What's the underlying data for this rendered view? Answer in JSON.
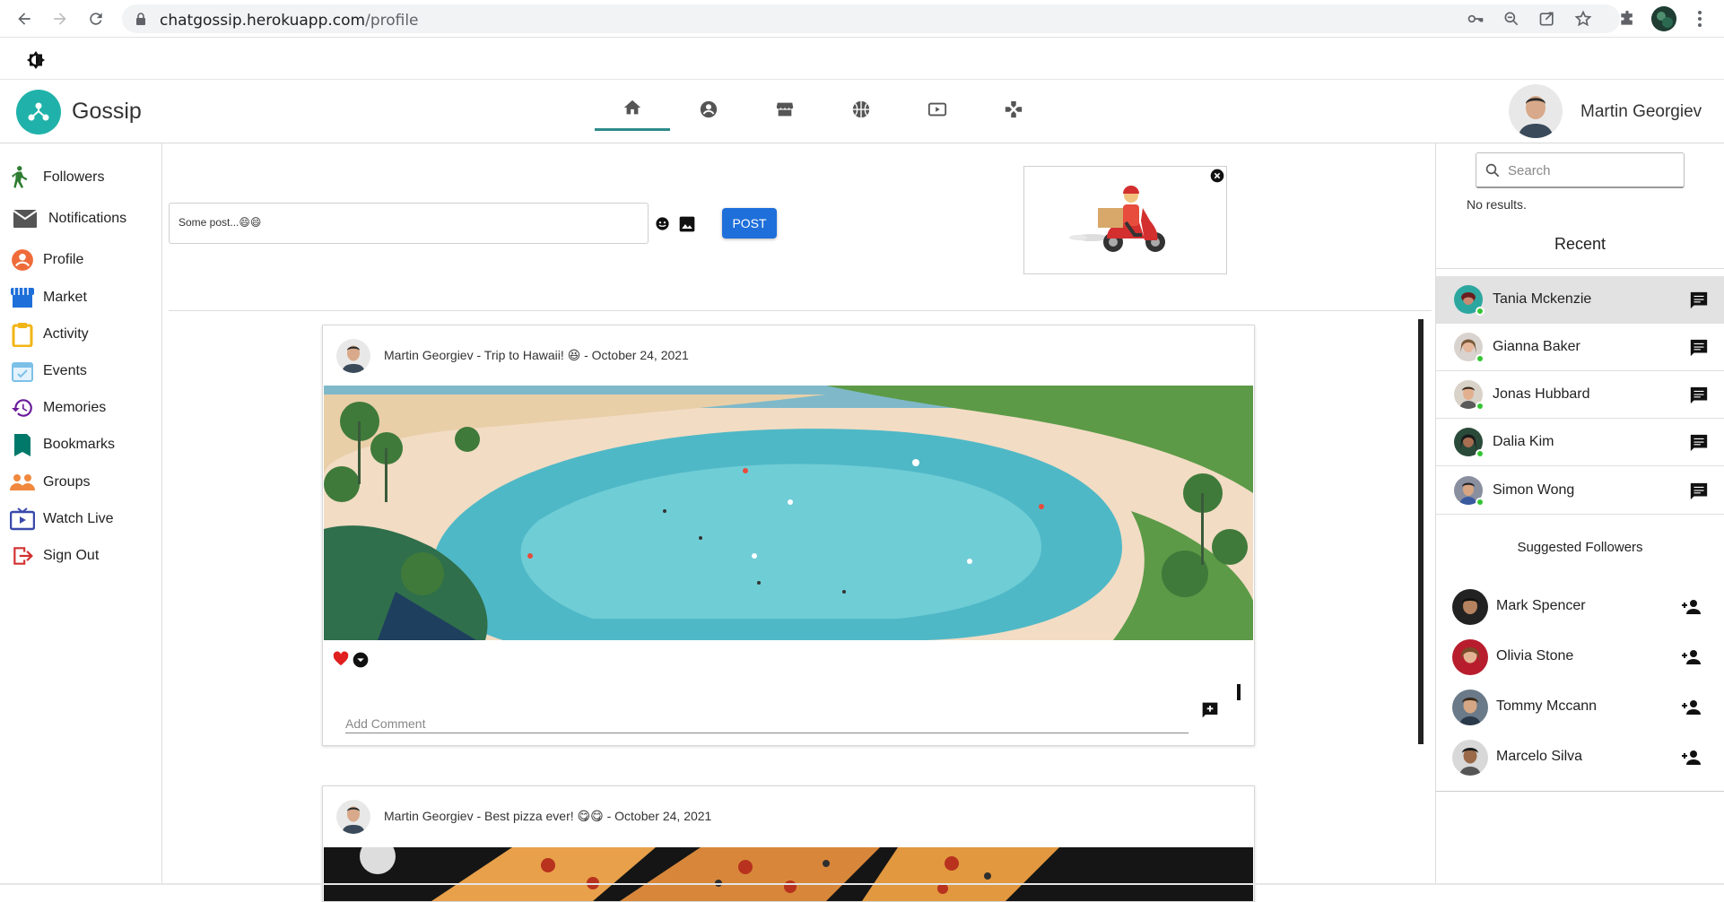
{
  "browser": {
    "url_host": "chatgossip.herokuapp.com",
    "url_path": "/profile"
  },
  "app": {
    "brand": "Gossip",
    "user_name": "Martin Georgiev"
  },
  "nav_tabs": [
    {
      "icon": "home-icon",
      "active": true
    },
    {
      "icon": "account-circle-icon",
      "active": false
    },
    {
      "icon": "store-icon",
      "active": false
    },
    {
      "icon": "sports-basketball-icon",
      "active": false
    },
    {
      "icon": "live-tv-icon",
      "active": false
    },
    {
      "icon": "games-icon",
      "active": false
    }
  ],
  "sidebar": {
    "items": [
      {
        "label": "Followers",
        "icon": "person-walking-icon",
        "color": "#2e7d32"
      },
      {
        "label": "Notifications",
        "icon": "mail-icon",
        "color": "#555555"
      },
      {
        "label": "Profile",
        "icon": "account-circle-icon",
        "color": "#ef6c3a"
      },
      {
        "label": "Market",
        "icon": "storefront-icon",
        "color": "#1e6fd9"
      },
      {
        "label": "Activity",
        "icon": "clipboard-icon",
        "color": "#f2b516"
      },
      {
        "label": "Events",
        "icon": "calendar-check-icon",
        "color": "#7cc0e8"
      },
      {
        "label": "Memories",
        "icon": "history-icon",
        "color": "#6a1b9a"
      },
      {
        "label": "Bookmarks",
        "icon": "bookmark-icon",
        "color": "#00796b"
      },
      {
        "label": "Groups",
        "icon": "groups-icon",
        "color": "#f0883e"
      },
      {
        "label": "Watch Live",
        "icon": "live-tv-icon",
        "color": "#3949ab"
      },
      {
        "label": "Sign Out",
        "icon": "exit-icon",
        "color": "#d32f2f"
      }
    ]
  },
  "composer": {
    "text": "Some post...😄😄",
    "post_button": "POST"
  },
  "posts": [
    {
      "author": "Martin Georgiev",
      "title": "Trip to Hawaii! 😆",
      "date": "October 24, 2021",
      "header": "Martin Georgiev - Trip to Hawaii! 😆 - October 24, 2021",
      "image": "beach-lagoon-photo",
      "comment_placeholder": "Add Comment"
    },
    {
      "author": "Martin Georgiev",
      "title": "Best pizza ever! 😋😋",
      "date": "October 24, 2021",
      "header": "Martin Georgiev - Best pizza ever! 😋😋 - October 24, 2021",
      "image": "pizza-photo"
    }
  ],
  "right": {
    "search_placeholder": "Search",
    "no_results": "No results.",
    "recent_title": "Recent",
    "recent": [
      {
        "name": "Tania Mckenzie",
        "selected": true
      },
      {
        "name": "Gianna Baker",
        "selected": false
      },
      {
        "name": "Jonas Hubbard",
        "selected": false
      },
      {
        "name": "Dalia Kim",
        "selected": false
      },
      {
        "name": "Simon Wong",
        "selected": false
      }
    ],
    "suggested_title": "Suggested Followers",
    "suggested": [
      {
        "name": "Mark Spencer"
      },
      {
        "name": "Olivia Stone"
      },
      {
        "name": "Tommy Mccann"
      },
      {
        "name": "Marcelo Silva"
      }
    ]
  }
}
